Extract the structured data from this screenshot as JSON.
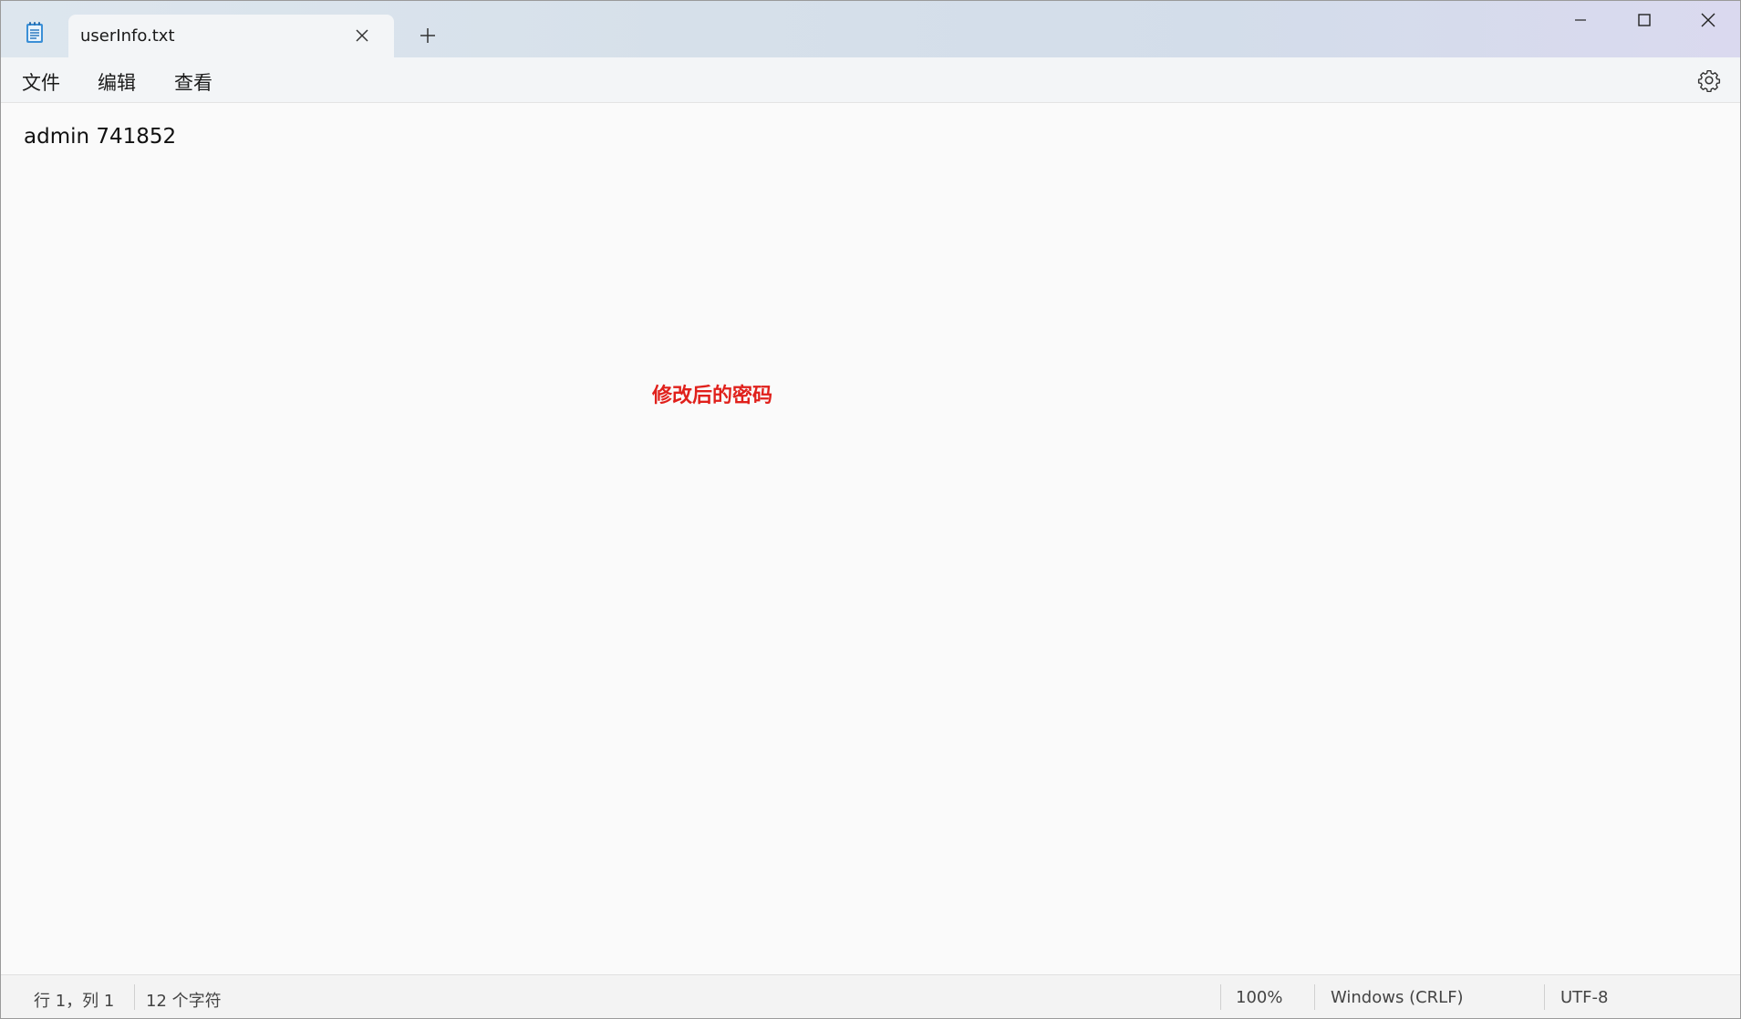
{
  "tab": {
    "title": "userInfo.txt"
  },
  "icons": {
    "app": "notepad-icon",
    "close_tab": "close-icon",
    "new_tab": "plus-icon",
    "minimize": "minimize-icon",
    "maximize": "maximize-icon",
    "close_window": "close-icon",
    "settings": "gear-icon"
  },
  "menu": {
    "file": "文件",
    "edit": "编辑",
    "view": "查看"
  },
  "editor": {
    "content": "admin 741852"
  },
  "annotation": {
    "text": "修改后的密码",
    "color": "#e0201b"
  },
  "status": {
    "position": "行 1，列 1",
    "char_count": "12 个字符",
    "zoom": "100%",
    "line_ending": "Windows (CRLF)",
    "encoding": "UTF-8"
  }
}
